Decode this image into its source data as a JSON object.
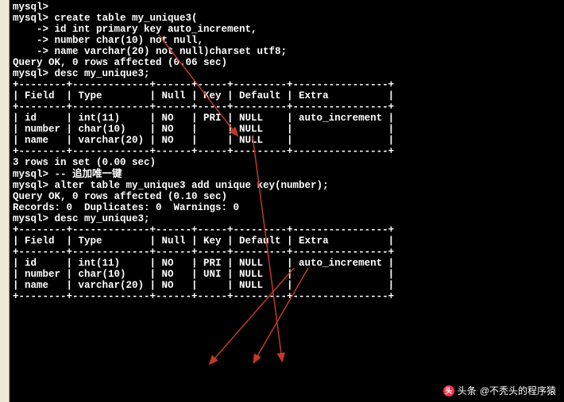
{
  "terminal": {
    "lines": [
      "mysql>",
      "mysql> create table my_unique3(",
      "    -> id int primary key auto_increment,",
      "    -> number char(10) not null,",
      "    -> name varchar(20) not null)charset utf8;",
      "Query OK, 0 rows affected (0.06 sec)",
      "",
      "mysql> desc my_unique3;",
      "+--------+-------------+------+-----+---------+----------------+",
      "| Field  | Type        | Null | Key | Default | Extra          |",
      "+--------+-------------+------+-----+---------+----------------+",
      "| id     | int(11)     | NO   | PRI | NULL    | auto_increment |",
      "| number | char(10)    | NO   |     | NULL    |                |",
      "| name   | varchar(20) | NO   |     | NULL    |                |",
      "+--------+-------------+------+-----+---------+----------------+",
      "3 rows in set (0.00 sec)",
      "",
      "mysql> -- 追加唯一键",
      "mysql> alter table my_unique3 add unique key(number);",
      "Query OK, 0 rows affected (0.10 sec)",
      "Records: 0  Duplicates: 0  Warnings: 0",
      "",
      "mysql> desc my_unique3;",
      "+--------+-------------+------+-----+---------+----------------+",
      "| Field  | Type        | Null | Key | Default | Extra          |",
      "+--------+-------------+------+-----+---------+----------------+",
      "| id     | int(11)     | NO   | PRI | NULL    | auto_increment |",
      "| number | char(10)    | NO   | UNI | NULL    |                |",
      "| name   | varchar(20) | NO   |     | NULL    |                |",
      "+--------+-------------+------+-----+---------+----------------+"
    ],
    "comment_zh": "追加唯一键"
  },
  "watermark": {
    "prefix": "头条",
    "author": "@不秃头的程序猿"
  },
  "desc_table_before": {
    "headers": [
      "Field",
      "Type",
      "Null",
      "Key",
      "Default",
      "Extra"
    ],
    "rows": [
      [
        "id",
        "int(11)",
        "NO",
        "PRI",
        "NULL",
        "auto_increment"
      ],
      [
        "number",
        "char(10)",
        "NO",
        "",
        "NULL",
        ""
      ],
      [
        "name",
        "varchar(20)",
        "NO",
        "",
        "NULL",
        ""
      ]
    ]
  },
  "desc_table_after": {
    "headers": [
      "Field",
      "Type",
      "Null",
      "Key",
      "Default",
      "Extra"
    ],
    "rows": [
      [
        "id",
        "int(11)",
        "NO",
        "PRI",
        "NULL",
        "auto_increment"
      ],
      [
        "number",
        "char(10)",
        "NO",
        "UNI",
        "NULL",
        ""
      ],
      [
        "name",
        "varchar(20)",
        "NO",
        "",
        "NULL",
        ""
      ]
    ]
  }
}
